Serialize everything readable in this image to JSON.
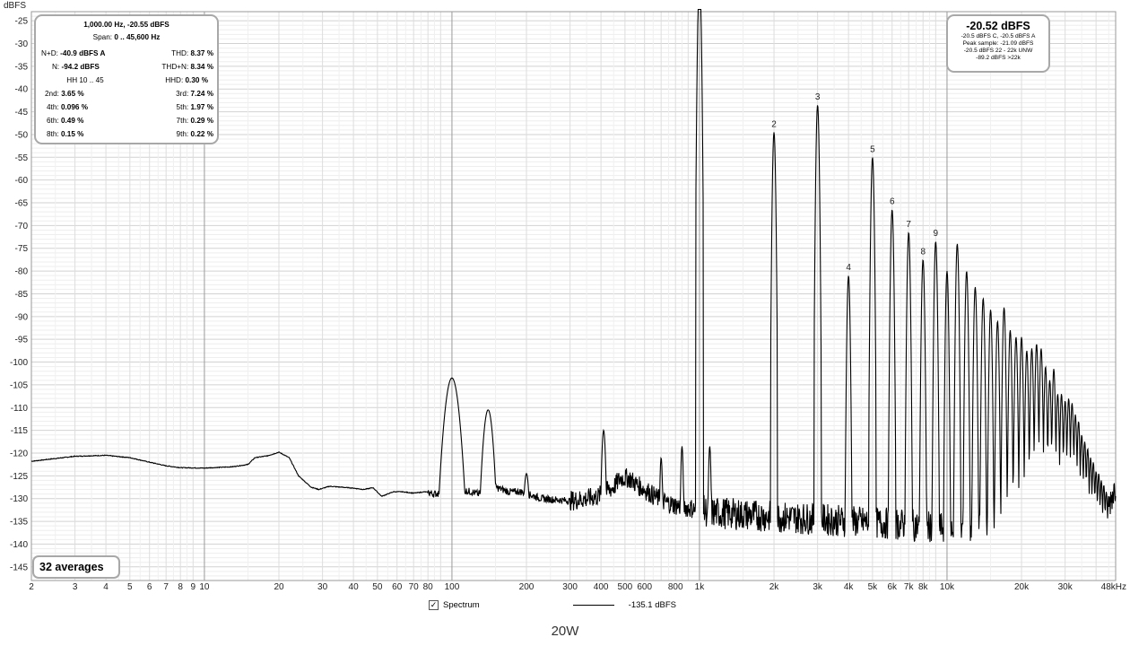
{
  "chart_data": {
    "type": "line",
    "ylabel": "dBFS",
    "xunit": "kHz",
    "xscale": "log",
    "xlim": [
      2,
      48000
    ],
    "ylim": [
      -148,
      -23
    ],
    "grid": true,
    "y_ticks": [
      "-25",
      "-30",
      "-35",
      "-40",
      "-45",
      "-50",
      "-55",
      "-60",
      "-65",
      "-70",
      "-75",
      "-80",
      "-85",
      "-90",
      "-95",
      "-100",
      "-105",
      "-110",
      "-115",
      "-120",
      "-125",
      "-130",
      "-135",
      "-140",
      "-145"
    ],
    "x_ticks": [
      {
        "v": 2,
        "label": "2"
      },
      {
        "v": 3,
        "label": "3"
      },
      {
        "v": 4,
        "label": "4"
      },
      {
        "v": 5,
        "label": "5"
      },
      {
        "v": 6,
        "label": "6"
      },
      {
        "v": 7,
        "label": "7"
      },
      {
        "v": 8,
        "label": "8"
      },
      {
        "v": 9,
        "label": "9"
      },
      {
        "v": 10,
        "label": "10"
      },
      {
        "v": 20,
        "label": "20"
      },
      {
        "v": 30,
        "label": "30"
      },
      {
        "v": 40,
        "label": "40"
      },
      {
        "v": 50,
        "label": "50"
      },
      {
        "v": 60,
        "label": "60"
      },
      {
        "v": 70,
        "label": "70"
      },
      {
        "v": 80,
        "label": "80"
      },
      {
        "v": 100,
        "label": "100"
      },
      {
        "v": 200,
        "label": "200"
      },
      {
        "v": 300,
        "label": "300"
      },
      {
        "v": 400,
        "label": "400"
      },
      {
        "v": 500,
        "label": "500"
      },
      {
        "v": 600,
        "label": "600"
      },
      {
        "v": 800,
        "label": "800"
      },
      {
        "v": 1000,
        "label": "1k"
      },
      {
        "v": 2000,
        "label": "2k"
      },
      {
        "v": 3000,
        "label": "3k"
      },
      {
        "v": 4000,
        "label": "4k"
      },
      {
        "v": 5000,
        "label": "5k"
      },
      {
        "v": 6000,
        "label": "6k"
      },
      {
        "v": 7000,
        "label": "7k"
      },
      {
        "v": 8000,
        "label": "8k"
      },
      {
        "v": 10000,
        "label": "10k"
      },
      {
        "v": 20000,
        "label": "20k"
      },
      {
        "v": 30000,
        "label": "30k"
      },
      {
        "v": 48000,
        "label": "48kHz"
      }
    ],
    "series": [
      {
        "color": "#000000",
        "baseline": [
          [
            2,
            -121.8
          ],
          [
            3,
            -120.7
          ],
          [
            4,
            -120.5
          ],
          [
            5,
            -121
          ],
          [
            6,
            -122
          ],
          [
            7,
            -122.8
          ],
          [
            8,
            -123.2
          ],
          [
            10,
            -123.3
          ],
          [
            13,
            -123
          ],
          [
            15,
            -122.5
          ],
          [
            16,
            -121
          ],
          [
            18,
            -120.6
          ],
          [
            20,
            -119.8
          ],
          [
            22,
            -121
          ],
          [
            24,
            -125
          ],
          [
            27,
            -127.5
          ],
          [
            29,
            -128
          ],
          [
            32,
            -127.3
          ],
          [
            36,
            -127.5
          ],
          [
            40,
            -127.7
          ],
          [
            44,
            -128
          ],
          [
            48,
            -127.6
          ],
          [
            52,
            -129.5
          ],
          [
            58,
            -128.5
          ],
          [
            63,
            -128.5
          ],
          [
            70,
            -128.8
          ],
          [
            78,
            -128.5
          ],
          [
            85,
            -129
          ],
          [
            93,
            -128.5
          ],
          [
            98,
            -128
          ],
          [
            105,
            -128
          ],
          [
            120,
            -128.5
          ],
          [
            128,
            -129
          ],
          [
            135,
            -128.5
          ],
          [
            150,
            -127.5
          ],
          [
            170,
            -128.5
          ],
          [
            190,
            -128.5
          ],
          [
            230,
            -130
          ],
          [
            300,
            -130.5
          ],
          [
            350,
            -130
          ],
          [
            390,
            -129.5
          ],
          [
            450,
            -127.5
          ],
          [
            480,
            -125.5
          ],
          [
            520,
            -125.5
          ],
          [
            560,
            -127
          ],
          [
            620,
            -128.5
          ],
          [
            700,
            -130.5
          ],
          [
            800,
            -131.5
          ],
          [
            900,
            -132
          ],
          [
            1100,
            -133
          ],
          [
            1500,
            -133.5
          ],
          [
            2000,
            -134
          ],
          [
            3000,
            -134.5
          ],
          [
            4000,
            -135
          ],
          [
            6000,
            -135.5
          ],
          [
            8000,
            -136
          ],
          [
            10000,
            -136.5
          ],
          [
            15000,
            -137
          ],
          [
            20000,
            -137.5
          ],
          [
            30000,
            -138
          ],
          [
            36000,
            -138
          ],
          [
            40000,
            -136
          ],
          [
            44000,
            -133
          ],
          [
            48000,
            -127
          ]
        ],
        "peaks": [
          [
            100,
            -103.5,
            7
          ],
          [
            140,
            -110.5,
            5
          ],
          [
            200,
            -124.5,
            3
          ],
          [
            410,
            -115,
            2
          ],
          [
            700,
            -121,
            1.4
          ],
          [
            850,
            -118.5,
            1.3
          ],
          [
            1000,
            -14,
            1.4
          ],
          [
            1100,
            -118.5,
            1.3
          ],
          [
            2000,
            -49.5,
            1.3
          ],
          [
            3000,
            -43.5,
            1.3
          ],
          [
            4000,
            -81,
            1.3
          ],
          [
            5000,
            -55,
            1.3
          ],
          [
            6000,
            -66.5,
            1.3
          ],
          [
            7000,
            -71.5,
            1.3
          ],
          [
            8000,
            -77.5,
            1.3
          ],
          [
            9000,
            -73.5,
            1.3
          ],
          [
            10000,
            -80,
            1.3
          ],
          [
            11000,
            -74,
            1.3
          ],
          [
            12000,
            -80,
            1.3
          ],
          [
            13000,
            -83.5,
            1.3
          ],
          [
            14000,
            -86,
            1.3
          ],
          [
            15000,
            -88.5,
            1.3
          ],
          [
            16000,
            -91,
            1.3
          ],
          [
            17000,
            -88,
            1.3
          ],
          [
            18000,
            -93,
            1.3
          ],
          [
            19000,
            -94.5,
            1.3
          ],
          [
            20000,
            -94.5,
            1.3
          ],
          [
            21000,
            -97.5,
            1.3
          ],
          [
            22000,
            -97,
            1.3
          ],
          [
            23000,
            -96,
            1.3
          ],
          [
            24000,
            -97,
            1.3
          ],
          [
            25000,
            -101,
            1.3
          ],
          [
            26000,
            -104,
            1.3
          ],
          [
            27000,
            -101.5,
            1.3
          ],
          [
            28000,
            -107,
            1.3
          ],
          [
            29000,
            -107,
            1.3
          ],
          [
            30000,
            -108.5,
            1.3
          ],
          [
            31000,
            -108,
            1.3
          ],
          [
            32000,
            -109,
            1.3
          ],
          [
            33000,
            -111.5,
            1.3
          ],
          [
            34000,
            -113,
            1.3
          ],
          [
            35000,
            -116,
            1.3
          ],
          [
            36000,
            -117.5,
            1.3
          ],
          [
            37000,
            -119,
            1.3
          ],
          [
            38000,
            -121,
            1.3
          ],
          [
            39000,
            -122,
            1.3
          ],
          [
            40000,
            -124,
            1.3
          ],
          [
            41000,
            -124.5,
            1.3
          ],
          [
            42000,
            -126,
            1.3
          ],
          [
            43000,
            -127,
            1.3
          ],
          [
            44000,
            -128.5,
            1.3
          ]
        ]
      }
    ],
    "harmonic_labels": [
      {
        "f": 2000,
        "db": -49.5,
        "label": "2"
      },
      {
        "f": 3000,
        "db": -43.5,
        "label": "3"
      },
      {
        "f": 4000,
        "db": -81,
        "label": "4"
      },
      {
        "f": 5000,
        "db": -55,
        "label": "5"
      },
      {
        "f": 6000,
        "db": -66.5,
        "label": "6"
      },
      {
        "f": 7000,
        "db": -71.5,
        "label": "7"
      },
      {
        "f": 8000,
        "db": -77.5,
        "label": "8"
      },
      {
        "f": 9000,
        "db": -73.5,
        "label": "9"
      }
    ]
  },
  "info_left": {
    "title": "1,000.00 Hz, -20.55 dBFS",
    "span_label": "Span:",
    "span_value": "0 .. 45,600 Hz",
    "nd_label": "N+D:",
    "nd_value": "-40.9 dBFS A",
    "thd_label": "THD:",
    "thd_value": "8.37 %",
    "n_label": "N:",
    "n_value": "-94.2 dBFS",
    "thdn_label": "THD+N:",
    "thdn_value": "8.34 %",
    "hh_label": "HH 10 .. 45",
    "hhd_label": "HHD:",
    "hhd_value": "0.30 %",
    "h2_label": "2nd:",
    "h2_value": "3.65 %",
    "h3_label": "3rd:",
    "h3_value": "7.24 %",
    "h4_label": "4th:",
    "h4_value": "0.096 %",
    "h5_label": "5th:",
    "h5_value": "1.97 %",
    "h6_label": "6th:",
    "h6_value": "0.49 %",
    "h7_label": "7th:",
    "h7_value": "0.29 %",
    "h8_label": "8th:",
    "h8_value": "0.15 %",
    "h9_label": "9th:",
    "h9_value": "0.22 %"
  },
  "info_right": {
    "level": "-20.52 dBFS",
    "line1": "-20.5 dBFS C, -20.5 dBFS A",
    "line2": "Peak sample: -21.09 dBFS",
    "line3": "-20.5 dBFS 22 - 22k UNW",
    "line4": "-89.2 dBFS >22k"
  },
  "averages_label": "32 averages",
  "legend": {
    "checkbox_label": "Spectrum",
    "checkbox_mark": "✓",
    "value": "-135.1 dBFS"
  },
  "footer_title": "20W"
}
